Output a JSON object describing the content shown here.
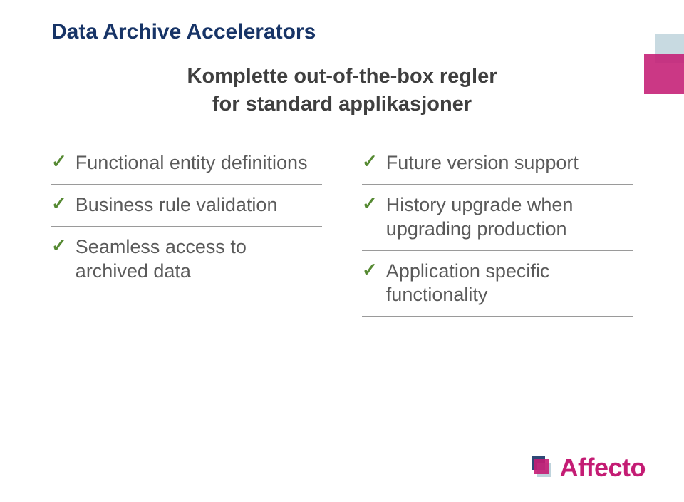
{
  "title": "Data Archive Accelerators",
  "subtitle_line1": "Komplette out-of-the-box regler",
  "subtitle_line2": "for standard applikasjoner",
  "left": {
    "items": [
      {
        "text": "Functional entity definitions"
      },
      {
        "text": "Business rule validation"
      },
      {
        "text": "Seamless access to archived data"
      }
    ]
  },
  "right": {
    "items": [
      {
        "text": "Future version support"
      },
      {
        "text": "History upgrade when upgrading production"
      },
      {
        "text": "Application specific functionality"
      }
    ]
  },
  "logo": {
    "text": "Affecto"
  },
  "colors": {
    "title": "#173467",
    "accent": "#c41c74",
    "check": "#568a33",
    "body": "#5a5a5a"
  }
}
